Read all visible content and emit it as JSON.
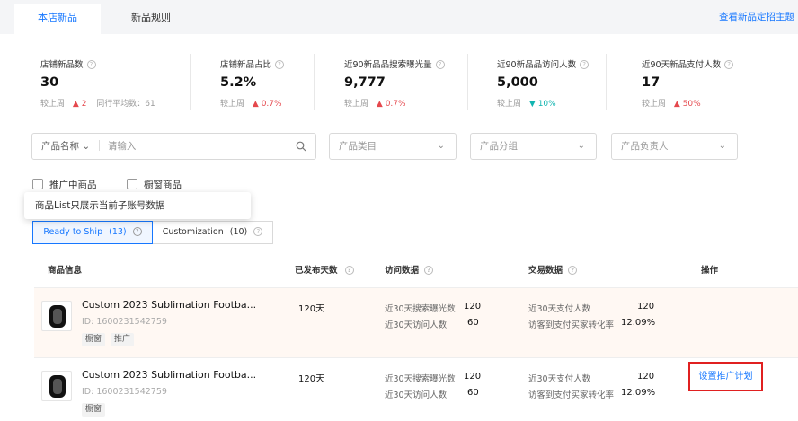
{
  "tabs": [
    {
      "label": "本店新品"
    },
    {
      "label": "新品规则"
    }
  ],
  "top_link": "查看新品定招主题",
  "stats": [
    {
      "label": "店铺新品数",
      "value": "30",
      "compare_label": "较上周",
      "change_arrow": "▲",
      "change": "2",
      "extra": "同行平均数：61"
    },
    {
      "label": "店铺新品占比",
      "value": "5.2%",
      "compare_label": "较上周",
      "change_arrow": "▲",
      "change": "0.7%"
    },
    {
      "label": "近90新品品搜索曝光量",
      "value": "9,777",
      "compare_label": "较上周",
      "change_arrow": "▲",
      "change": "0.7%"
    },
    {
      "label": "近90新品品访问人数",
      "value": "5,000",
      "compare_label": "较上周",
      "change_arrow": "▼",
      "change": "10%"
    },
    {
      "label": "近90天新品支付人数",
      "value": "17",
      "compare_label": "较上周",
      "change_arrow": "▲",
      "change": "50%"
    }
  ],
  "filters": {
    "product_name_label": "产品名称",
    "product_name_placeholder": "请输入",
    "category": "产品类目",
    "group": "产品分组",
    "owner": "产品负责人"
  },
  "checkboxes": [
    {
      "label": "推广中商品"
    },
    {
      "label": "橱窗商品"
    }
  ],
  "tooltip": "商品List只展示当前子账号数据",
  "segments": [
    {
      "label": "Ready to Ship",
      "count": "(13)"
    },
    {
      "label": "Customization",
      "count": "(10)"
    }
  ],
  "table": {
    "headers": {
      "info": "商品信息",
      "days": "已发布天数",
      "visit": "访问数据",
      "trade": "交易数据",
      "ops": "操作"
    },
    "rows": [
      {
        "name": "Custom 2023 Sublimation Footba...",
        "id": "ID: 1600231542759",
        "tags": [
          "橱窗",
          "推广"
        ],
        "days": "120天",
        "exposure_label": "近30天搜索曝光数",
        "exposure": "120",
        "visitors_label": "近30天访问人数",
        "visitors": "60",
        "payers_label": "近30天支付人数",
        "payers": "120",
        "conversion_label": "访客到支付买家转化率",
        "conversion": "12.09%",
        "action": ""
      },
      {
        "name": "Custom 2023 Sublimation Footba...",
        "id": "ID: 1600231542759",
        "tags": [
          "橱窗"
        ],
        "days": "120天",
        "exposure_label": "近30天搜索曝光数",
        "exposure": "120",
        "visitors_label": "近30天访问人数",
        "visitors": "60",
        "payers_label": "近30天支付人数",
        "payers": "120",
        "conversion_label": "访客到支付买家转化率",
        "conversion": "12.09%",
        "action": "设置推广计划"
      }
    ]
  },
  "colors": {
    "accent": "#1677ff",
    "up": "#e5484d",
    "down": "#13b5b1",
    "highlight_border": "#e02020",
    "highlight_row": "#fff8f3"
  }
}
